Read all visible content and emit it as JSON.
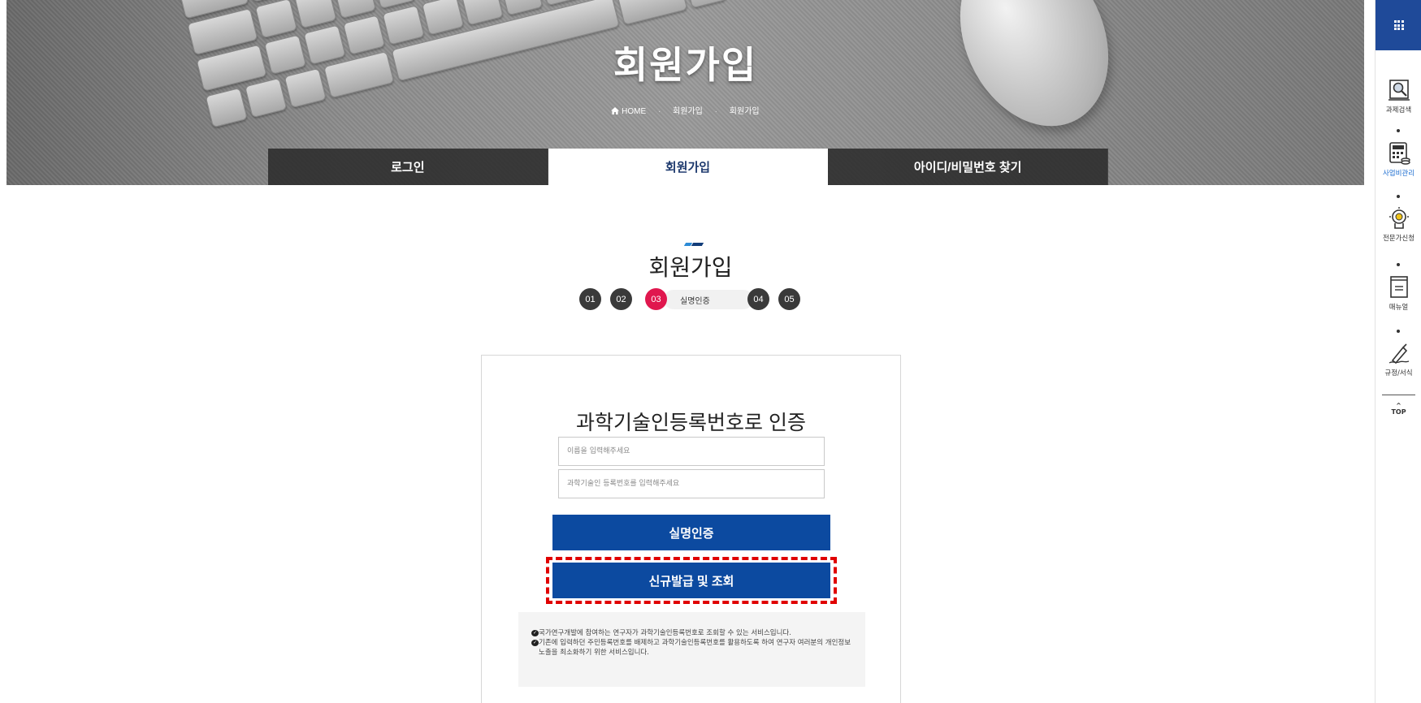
{
  "hero": {
    "title": "회원가입",
    "breadcrumb": {
      "home": "HOME",
      "level1": "회원가입",
      "level2": "회원가입"
    }
  },
  "tabs": [
    {
      "label": "로그인",
      "active": false
    },
    {
      "label": "회원가입",
      "active": true
    },
    {
      "label": "아이디/비밀번호 찾기",
      "active": false
    }
  ],
  "section_title": "회원가입",
  "steps": {
    "items": [
      "01",
      "02",
      "03",
      "04",
      "05"
    ],
    "current_index": 2,
    "current_label": "실명인증",
    "current_color": "#e0174e"
  },
  "form": {
    "title": "과학기술인등록번호로 인증",
    "name_placeholder": "이름을 입력해주세요",
    "reg_placeholder": "과학기술인 등록번호를 입력해주세요",
    "verify_button": "실명인증",
    "issue_button": "신규발급 및 조회",
    "button_color": "#0c4aa0",
    "highlight_color": "#e00000",
    "notes": [
      "국가연구개발에 참여하는 연구자가 과학기술인등록번호로 조회할 수 있는 서비스입니다.",
      "기존에 입력하던 주민등록번호를 배제하고 과학기술인등록번호를 활용하도록 하여 연구자 여러분의 개인정보 노출을 최소화하기 위한 서비스입니다."
    ]
  },
  "sidebar": {
    "menu_icon": "grid-icon",
    "items": [
      {
        "label": "과제검색",
        "icon": "search-document-icon",
        "active": false
      },
      {
        "label": "사업비관리",
        "icon": "calculator-icon",
        "active": true
      },
      {
        "label": "전문가신청",
        "icon": "expert-head-icon",
        "active": false
      },
      {
        "label": "매뉴얼",
        "icon": "manual-book-icon",
        "active": false
      },
      {
        "label": "규정/서식",
        "icon": "pen-icon",
        "active": false
      }
    ],
    "top_label": "TOP",
    "accent": "#1f4a99"
  }
}
